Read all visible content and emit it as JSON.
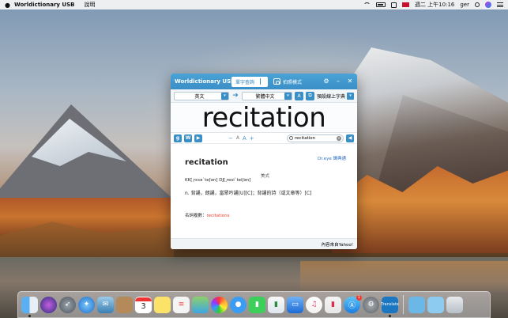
{
  "menubar": {
    "app_name": "Worldictionary USB",
    "menu_item": "說明",
    "clock": "週二 上午10:16",
    "user": "ger"
  },
  "window": {
    "title": "Worldictionary USB",
    "tab_word_lookup": "單字查詢",
    "tab_photo_mode": "拍照模式",
    "source_lang": "英文",
    "target_lang": "繁體中文",
    "dictionary_select": "預設線上字典",
    "big_word": "recitation",
    "zoom_small": "A",
    "zoom_large": "A",
    "search_value": "recitation",
    "source_link": "Dr.eye 譯典通",
    "headword": "recitation",
    "accent_label": "美式",
    "phonetic": "KK[͵rɛsəˋteʃən]  DJ[͵resiˋteiʃən]",
    "definition": "n.  背誦，朗誦，當眾吟誦[U][C]；背誦的詩（或文章等）[C]",
    "related_label": "名詞複數：",
    "related_word": "recitations",
    "footer": "內容來自Yahoo!"
  },
  "dock": {
    "calendar_day": "3",
    "appstore_badge": "1",
    "translate_label": "Translate"
  },
  "colors": {
    "accent": "#3a8fc6",
    "link": "#2b6fc3",
    "related_word": "#e2402f"
  }
}
